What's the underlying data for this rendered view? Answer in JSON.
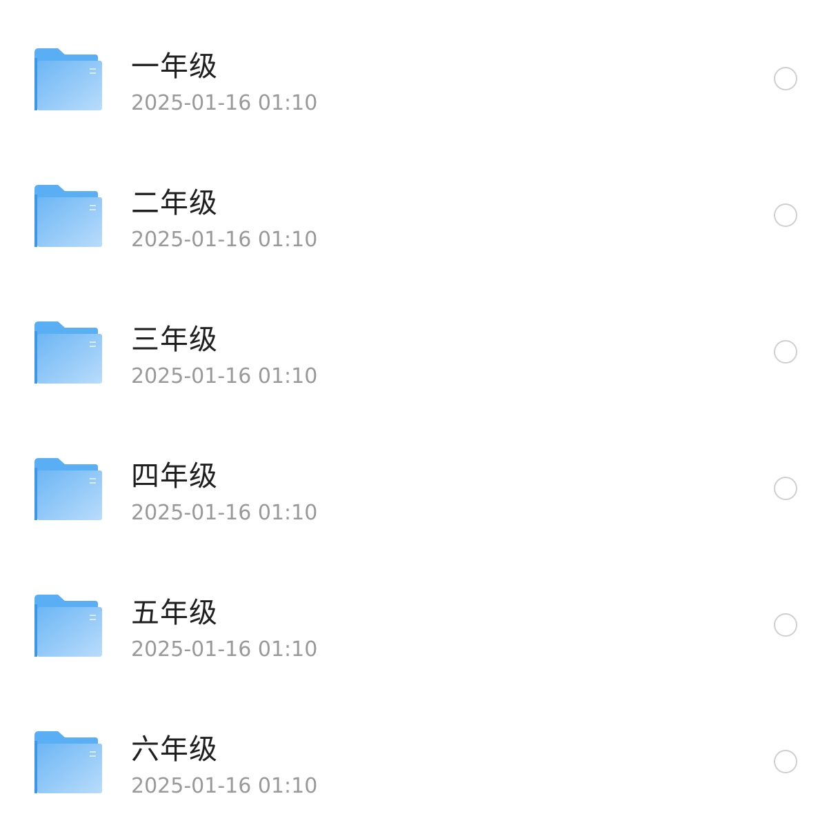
{
  "colors": {
    "folder_tab": "#5aaef3",
    "folder_front_start": "#6db6f5",
    "folder_front_end": "#b9dcfb",
    "name_text": "#1f1f1f",
    "date_text": "#999999",
    "radio_border": "#cfcfcf"
  },
  "icons": {
    "item_icon": "folder-icon",
    "select_icon": "radio-unchecked-icon"
  },
  "items": [
    {
      "name": "一年级",
      "date": "2025-01-16 01:10",
      "selected": false
    },
    {
      "name": "二年级",
      "date": "2025-01-16 01:10",
      "selected": false
    },
    {
      "name": "三年级",
      "date": "2025-01-16 01:10",
      "selected": false
    },
    {
      "name": "四年级",
      "date": "2025-01-16 01:10",
      "selected": false
    },
    {
      "name": "五年级",
      "date": "2025-01-16 01:10",
      "selected": false
    },
    {
      "name": "六年级",
      "date": "2025-01-16 01:10",
      "selected": false
    }
  ]
}
